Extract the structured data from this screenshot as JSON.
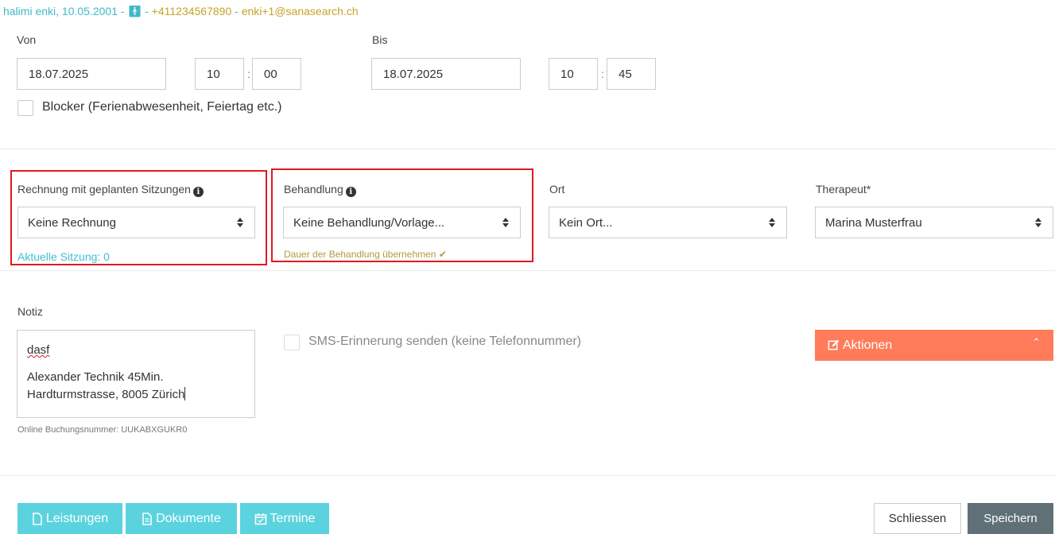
{
  "header": {
    "name_dob": "halimi enki, 10.05.2001 -",
    "dash1": "-",
    "phone": "+411234567890",
    "dash2": "-",
    "email": "enki+1@sanasearch.ch"
  },
  "time": {
    "von_label": "Von",
    "bis_label": "Bis",
    "von_date": "18.07.2025",
    "von_hour": "10",
    "von_minute": "00",
    "bis_date": "18.07.2025",
    "bis_hour": "10",
    "bis_minute": "45",
    "colon": ":",
    "blocker_label": "Blocker (Ferienabwesenheit, Feiertag etc.)"
  },
  "fields": {
    "rechnung_label": "Rechnung mit geplanten Sitzungen",
    "rechnung_value": "Keine Rechnung",
    "aktuelle_sitzung": "Aktuelle Sitzung: 0",
    "behandlung_label": "Behandlung",
    "behandlung_value": "Keine Behandlung/Vorlage...",
    "dauer_link": "Dauer der Behandlung übernehmen",
    "ort_label": "Ort",
    "ort_value": "Kein Ort...",
    "therapeut_label": "Therapeut*",
    "therapeut_value": "Marina Musterfrau"
  },
  "notiz": {
    "label": "Notiz",
    "line1": "dasf",
    "line2": "Alexander Technik 45Min.",
    "line3": "Hardturmstrasse, 8005 Zürich",
    "booking_number": "Online Buchungsnummer: UUKABXGUKR0",
    "sms_label": "SMS-Erinnerung senden (keine Telefonnummer)"
  },
  "actions": {
    "aktionen_label": "Aktionen"
  },
  "footer": {
    "leistungen": "Leistungen",
    "dokumente": "Dokumente",
    "termine": "Termine",
    "schliessen": "Schliessen",
    "speichern": "Speichern"
  },
  "colors": {
    "teal": "#5bd3df",
    "orange": "#ff7b5a",
    "red_highlight": "#e0191f",
    "dark_button": "#5f7176",
    "gold": "#c9a227"
  }
}
